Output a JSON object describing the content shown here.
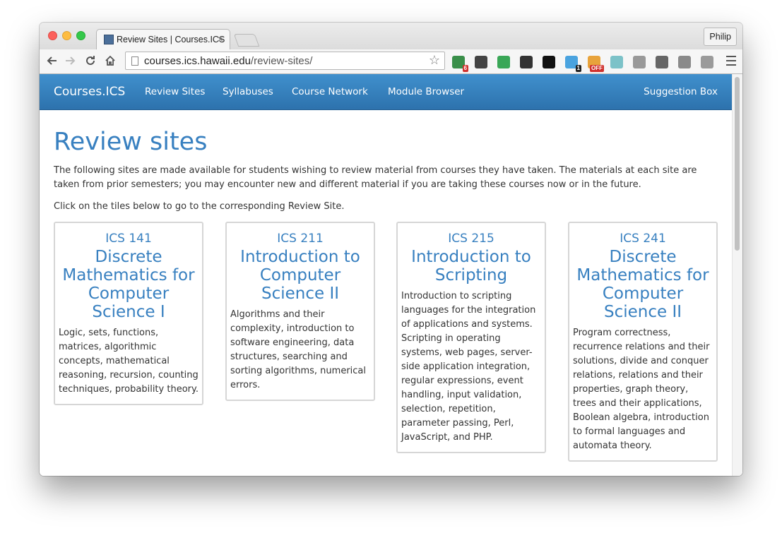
{
  "browser": {
    "tab_title": "Review Sites | Courses.ICS",
    "tab_close": "×",
    "profile_name": "Philip",
    "url_host": "courses.ics.hawaii.edu",
    "url_path": "/review-sites/",
    "extensions": [
      {
        "icon": "octopus-extension-icon",
        "color": "#3a8f4a",
        "badge": "6",
        "badge_color": "#d0312d"
      },
      {
        "icon": "sync-extension-icon",
        "color": "#444444"
      },
      {
        "icon": "hangouts-extension-icon",
        "color": "#3aa757"
      },
      {
        "icon": "info-extension-icon",
        "color": "#333333"
      },
      {
        "icon": "jetbrains-extension-icon",
        "color": "#111111"
      },
      {
        "icon": "ghostery-extension-icon",
        "color": "#4aa3df",
        "badge": "1",
        "badge_color": "#222222"
      },
      {
        "icon": "chart-off-extension-icon",
        "color": "#e8a33b",
        "badge": "OFF",
        "badge_color": "#d0312d"
      },
      {
        "icon": "screenshot-extension-icon",
        "color": "#7cc2c8"
      },
      {
        "icon": "copy-extension-icon",
        "color": "#999999"
      },
      {
        "icon": "camera-extension-icon",
        "color": "#666666"
      },
      {
        "icon": "drive-extension-icon",
        "color": "#8a8a8a"
      },
      {
        "icon": "puzzle-extension-icon",
        "color": "#9a9a9a"
      }
    ]
  },
  "site": {
    "brand": "Courses.ICS",
    "nav": [
      "Review Sites",
      "Syllabuses",
      "Course Network",
      "Module Browser"
    ],
    "suggestion": "Suggestion Box"
  },
  "page": {
    "title": "Review sites",
    "intro": "The following sites are made available for students wishing to review material from courses they have taken. The materials at each site are taken from prior semesters; you may encounter new and different material if you are taking these courses now or in the future.",
    "instructions": "Click on the tiles below to go to the corresponding Review Site.",
    "tiles": [
      {
        "code": "ICS 141",
        "name": "Discrete Mathematics for Computer Science I",
        "description": "Logic, sets, functions, matrices, algorithmic concepts, mathematical reasoning, recursion, counting techniques, probability theory."
      },
      {
        "code": "ICS 211",
        "name": "Introduction to Computer Science II",
        "description": "Algorithms and their complexity, introduction to software engineering, data structures, searching and sorting algorithms, numerical errors."
      },
      {
        "code": "ICS 215",
        "name": "Introduction to Scripting",
        "description": "Introduction to scripting languages for the integration of applications and systems. Scripting in operating systems, web pages, server-side application integration, regular expressions, event handling, input validation, selection, repetition, parameter passing, Perl, JavaScript, and PHP."
      },
      {
        "code": "ICS 241",
        "name": "Discrete Mathematics for Computer Science II",
        "description": "Program correctness, recurrence relations and their solutions, divide and conquer relations, relations and their properties, graph theory, trees and their applications, Boolean algebra, introduction to formal languages and automata theory."
      }
    ]
  }
}
